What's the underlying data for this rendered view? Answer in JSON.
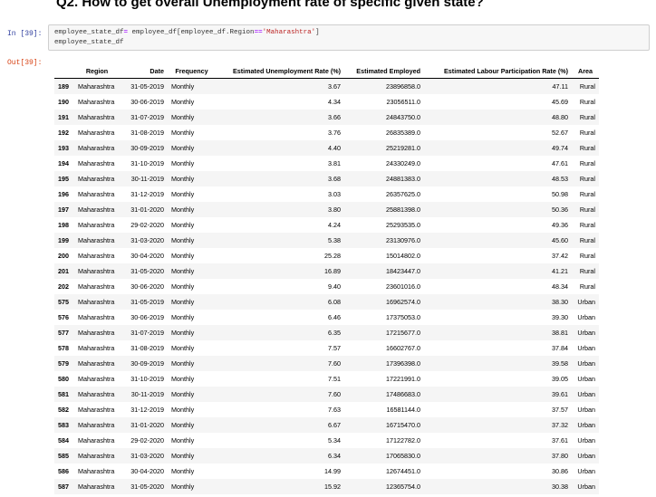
{
  "heading": "Q2. How to get overall Unemployment rate of specific given state?",
  "in_prompt": "In [39]:",
  "out_prompt": "Out[39]:",
  "code": {
    "line1_prefix": "employee_state_df",
    "line1_op1": "=",
    "line1_mid": " employee_df[employee_df.Region",
    "line1_op2": "==",
    "line1_str": "'Maharashtra'",
    "line1_suffix": "]",
    "line2": "employee_state_df"
  },
  "table": {
    "columns": [
      "",
      "Region",
      "Date",
      "Frequency",
      "Estimated Unemployment Rate (%)",
      "Estimated Employed",
      "Estimated Labour Participation Rate (%)",
      "Area"
    ],
    "rows": [
      [
        "189",
        "Maharashtra",
        "31-05-2019",
        "Monthly",
        "3.67",
        "23896858.0",
        "47.11",
        "Rural"
      ],
      [
        "190",
        "Maharashtra",
        "30-06-2019",
        "Monthly",
        "4.34",
        "23056511.0",
        "45.69",
        "Rural"
      ],
      [
        "191",
        "Maharashtra",
        "31-07-2019",
        "Monthly",
        "3.66",
        "24843750.0",
        "48.80",
        "Rural"
      ],
      [
        "192",
        "Maharashtra",
        "31-08-2019",
        "Monthly",
        "3.76",
        "26835389.0",
        "52.67",
        "Rural"
      ],
      [
        "193",
        "Maharashtra",
        "30-09-2019",
        "Monthly",
        "4.40",
        "25219281.0",
        "49.74",
        "Rural"
      ],
      [
        "194",
        "Maharashtra",
        "31-10-2019",
        "Monthly",
        "3.81",
        "24330249.0",
        "47.61",
        "Rural"
      ],
      [
        "195",
        "Maharashtra",
        "30-11-2019",
        "Monthly",
        "3.68",
        "24881383.0",
        "48.53",
        "Rural"
      ],
      [
        "196",
        "Maharashtra",
        "31-12-2019",
        "Monthly",
        "3.03",
        "26357625.0",
        "50.98",
        "Rural"
      ],
      [
        "197",
        "Maharashtra",
        "31-01-2020",
        "Monthly",
        "3.80",
        "25881398.0",
        "50.36",
        "Rural"
      ],
      [
        "198",
        "Maharashtra",
        "29-02-2020",
        "Monthly",
        "4.24",
        "25293535.0",
        "49.36",
        "Rural"
      ],
      [
        "199",
        "Maharashtra",
        "31-03-2020",
        "Monthly",
        "5.38",
        "23130976.0",
        "45.60",
        "Rural"
      ],
      [
        "200",
        "Maharashtra",
        "30-04-2020",
        "Monthly",
        "25.28",
        "15014802.0",
        "37.42",
        "Rural"
      ],
      [
        "201",
        "Maharashtra",
        "31-05-2020",
        "Monthly",
        "16.89",
        "18423447.0",
        "41.21",
        "Rural"
      ],
      [
        "202",
        "Maharashtra",
        "30-06-2020",
        "Monthly",
        "9.40",
        "23601016.0",
        "48.34",
        "Rural"
      ],
      [
        "575",
        "Maharashtra",
        "31-05-2019",
        "Monthly",
        "6.08",
        "16962574.0",
        "38.30",
        "Urban"
      ],
      [
        "576",
        "Maharashtra",
        "30-06-2019",
        "Monthly",
        "6.46",
        "17375053.0",
        "39.30",
        "Urban"
      ],
      [
        "577",
        "Maharashtra",
        "31-07-2019",
        "Monthly",
        "6.35",
        "17215677.0",
        "38.81",
        "Urban"
      ],
      [
        "578",
        "Maharashtra",
        "31-08-2019",
        "Monthly",
        "7.57",
        "16602767.0",
        "37.84",
        "Urban"
      ],
      [
        "579",
        "Maharashtra",
        "30-09-2019",
        "Monthly",
        "7.60",
        "17396398.0",
        "39.58",
        "Urban"
      ],
      [
        "580",
        "Maharashtra",
        "31-10-2019",
        "Monthly",
        "7.51",
        "17221991.0",
        "39.05",
        "Urban"
      ],
      [
        "581",
        "Maharashtra",
        "30-11-2019",
        "Monthly",
        "7.60",
        "17486683.0",
        "39.61",
        "Urban"
      ],
      [
        "582",
        "Maharashtra",
        "31-12-2019",
        "Monthly",
        "7.63",
        "16581144.0",
        "37.57",
        "Urban"
      ],
      [
        "583",
        "Maharashtra",
        "31-01-2020",
        "Monthly",
        "6.67",
        "16715470.0",
        "37.32",
        "Urban"
      ],
      [
        "584",
        "Maharashtra",
        "29-02-2020",
        "Monthly",
        "5.34",
        "17122782.0",
        "37.61",
        "Urban"
      ],
      [
        "585",
        "Maharashtra",
        "31-03-2020",
        "Monthly",
        "6.34",
        "17065830.0",
        "37.80",
        "Urban"
      ],
      [
        "586",
        "Maharashtra",
        "30-04-2020",
        "Monthly",
        "14.99",
        "12674451.0",
        "30.86",
        "Urban"
      ],
      [
        "587",
        "Maharashtra",
        "31-05-2020",
        "Monthly",
        "15.92",
        "12365754.0",
        "30.38",
        "Urban"
      ]
    ]
  }
}
